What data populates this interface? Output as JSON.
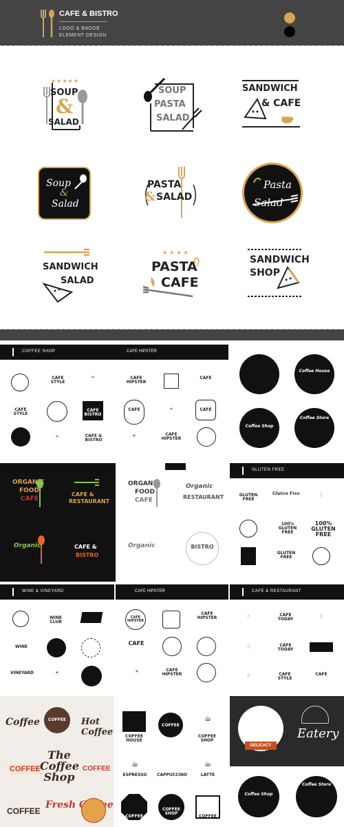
{
  "header": {
    "title": "CAFE & BISTRO",
    "subtitle_line1": "LOGO & BADGE",
    "subtitle_line2": "ELEMENT  DESIGN",
    "swatches": [
      "#d9a453",
      "#111111"
    ],
    "background": "#444444"
  },
  "logos": {
    "soup_salad": {
      "w1": "SOUP",
      "amp": "&",
      "w2": "SALAD"
    },
    "soup_pasta_salad": {
      "w1": "SOUP",
      "w2": "PASTA",
      "w3": "SALAD"
    },
    "sandwich_cafe": {
      "w1": "SANDWICH",
      "w2": "& CAFE"
    },
    "soup_salad_script": {
      "w1": "Soup",
      "amp": "&",
      "w2": "Salad"
    },
    "pasta_salad": {
      "w1": "PASTA",
      "amp": "&",
      "w2": "SALAD"
    },
    "pasta_salad_script": {
      "w1": "Pasta",
      "w2": "Salad"
    },
    "sandwich_salad": {
      "w1": "SANDWICH",
      "w2": "SALAD"
    },
    "pasta_cafe": {
      "w1": "PASTA",
      "w2": "CAFE"
    },
    "sandwich_shop": {
      "w1": "SANDWICH",
      "w2": "SHOP"
    }
  },
  "colors": {
    "accent": "#d9a453",
    "dark": "#111111",
    "grey": "#9a9a9a"
  },
  "panels": {
    "coffee_shop": {
      "strip": "COFFEE SHOP",
      "labels": [
        "CAFE STYLE",
        "CAFE HIPSTER",
        "CAFE",
        "CAFE STYLE",
        "CAFE BISTRO",
        "CAFE",
        "CAFE",
        "CAFE & BISTRO",
        "CAFE HIPSTER",
        "CAFE"
      ]
    },
    "cafe_hipster": {
      "strip": "CAFE HIPSTER"
    },
    "coffee_house": {
      "labels": [
        "Coffee House",
        "Coffee Shop",
        "Coffee Store"
      ]
    },
    "organic": {
      "l1": "ORGANIC",
      "l2": "FOOD",
      "l3": "CAFE",
      "r1": "CAFE &",
      "r2": "RESTAURANT",
      "r3": "Organic",
      "r4": "CAFE &",
      "r5": "BISTRO"
    },
    "gluten": {
      "strip": "GLUTEN FREE",
      "labels": [
        "GLUTEN FREE",
        "Gluten Free",
        "100% GLUTEN FREE",
        "GLUTEN FREE",
        "100% GLUTEN FREE",
        "GLUTEN FREE"
      ]
    },
    "wine": {
      "strip": "WINE & VINEYARD",
      "labels": [
        "WINE CLUB",
        "WINE",
        "WINE",
        "VINEYARD"
      ]
    },
    "hipster2": {
      "strip": "CAFE HIPSTER",
      "labels": [
        "CAFE HIPSTER",
        "CAFE HIPSTER",
        "CAFE",
        "CAFE HIPSTER"
      ]
    },
    "restaurant": {
      "strip": "CAFE & RESTAURANT",
      "labels": [
        "CAFE TODAY",
        "CAFE TODAY",
        "CAFE STYLE",
        "CAFE"
      ]
    },
    "coffee_types": {
      "labels": [
        "Coffee",
        "COFFEE",
        "The Coffee Shop",
        "COFFEE",
        "Fresh Coffee",
        "COFFEE",
        "Hot Coffee"
      ]
    },
    "coffee_icons": {
      "labels": [
        "COFFEE HOUSE",
        "COFFEE",
        "COFFEE SHOP",
        "ESPRESSO",
        "CAPPUCCINO",
        "LATTE",
        "COFFEE",
        "COFFEE SHOP",
        "COFFEE"
      ]
    },
    "eatery": {
      "labels": [
        "Eatery",
        "DELICACY"
      ]
    }
  }
}
